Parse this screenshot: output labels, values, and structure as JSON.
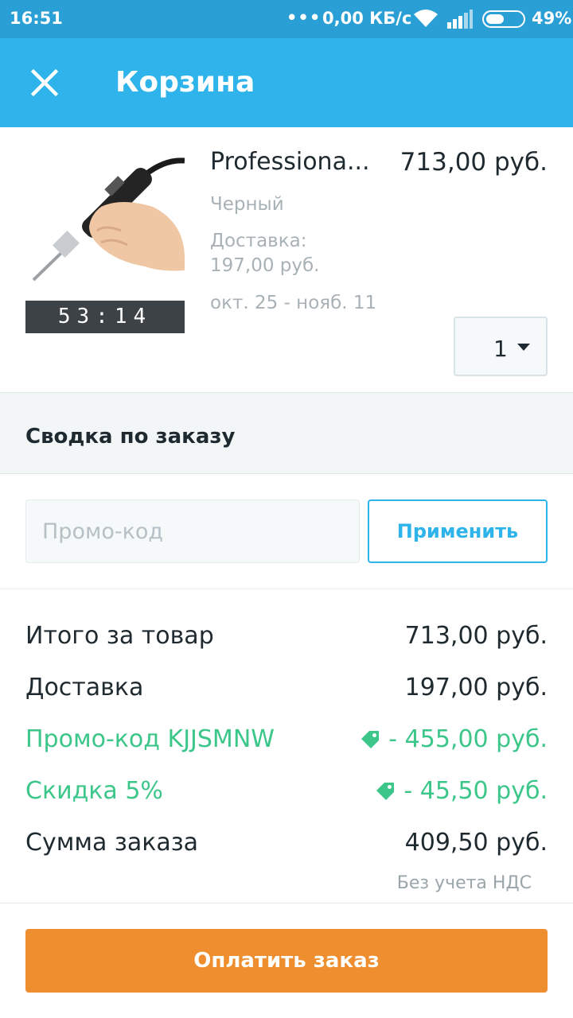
{
  "status_bar": {
    "time": "16:51",
    "dots": "•••",
    "network_speed": "0,00 КБ/с",
    "battery_level": "49%",
    "battery_fraction": 0.49
  },
  "header": {
    "title": "Корзина",
    "close_icon": "close-icon"
  },
  "product": {
    "name": "Professiona...",
    "price": "713,00 руб.",
    "variant": "Черный",
    "delivery_label": "Доставка:",
    "delivery_price": "197,00 руб.",
    "delivery_dates": "окт. 25 - нояб. 11",
    "timer": "53:14",
    "quantity": "1"
  },
  "summary": {
    "title": "Сводка по заказу",
    "promo_placeholder": "Промо-код",
    "promo_value": "",
    "apply_label": "Применить",
    "rows": [
      {
        "label": "Итого за товар",
        "value": "713,00 руб."
      },
      {
        "label": "Доставка",
        "value": "197,00 руб."
      },
      {
        "label": "Промо-код KJJSMNW",
        "value": "- 455,00 руб.",
        "icon": "tag-icon"
      },
      {
        "label": "Скидка 5%",
        "value": "- 45,50 руб.",
        "icon": "tag-icon"
      },
      {
        "label": "Сумма заказа",
        "value": "409,50 руб."
      }
    ],
    "vat_note": "Без учета НДС"
  },
  "pay_button": {
    "label": "Оплатить заказ"
  },
  "colors": {
    "appbar": "#2eb4ea",
    "statusbar": "#2a9fd6",
    "discount_green": "#3cc68a",
    "pay_orange": "#ef8e2e"
  }
}
